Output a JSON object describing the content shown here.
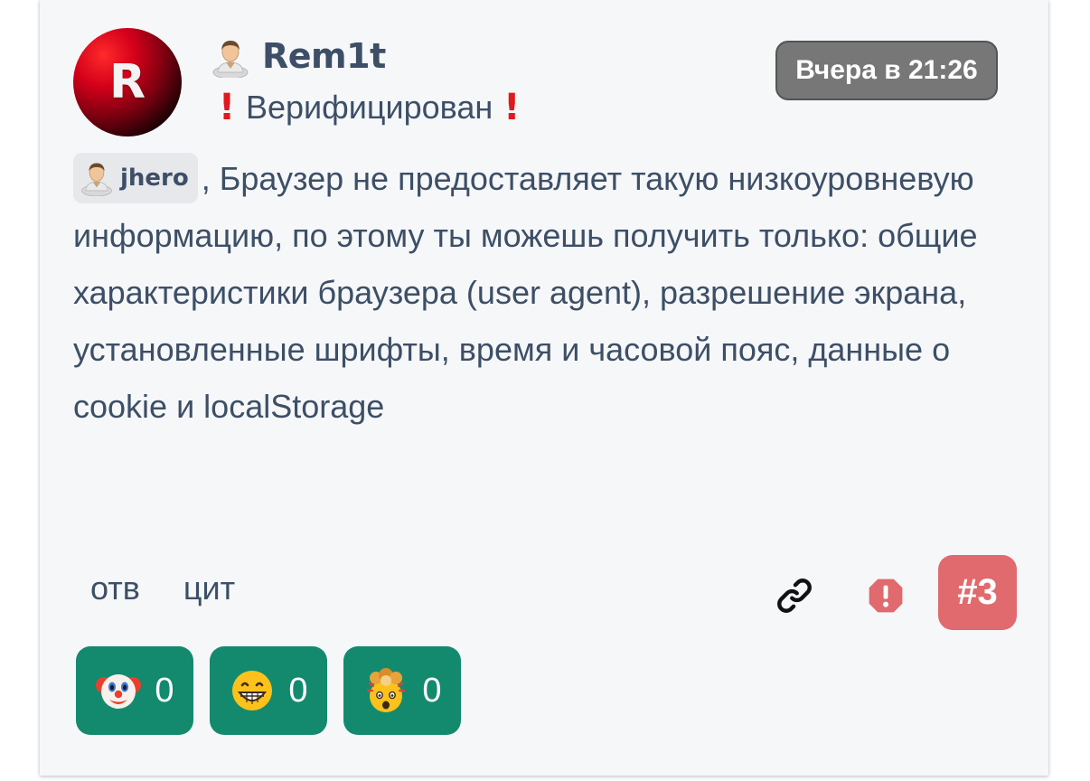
{
  "post": {
    "avatar_letter": "R",
    "username": "Rem1t",
    "user_status": "Верифицирован",
    "date": "Вчера в 21:26",
    "mention": "jhero",
    "message_text": ", Браузер не предоставляет такую низкоуровневую информацию, по этому ты можешь получить только: общие характеристики браузера (user agent), разрешение экрана, установленные шрифты, время и часовой пояс, данные о cookie и localStorage",
    "actions": {
      "reply_label": "отв",
      "quote_label": "цит"
    },
    "post_number": "#3",
    "reactions": [
      {
        "icon": "clown-face-icon",
        "count": "0"
      },
      {
        "icon": "grinning-face-icon",
        "count": "0"
      },
      {
        "icon": "exploding-head-icon",
        "count": "0"
      }
    ]
  },
  "colors": {
    "text": "#3d4f66",
    "date_badge": "#777777",
    "post_number": "#e06a6e",
    "reaction": "#138a6e",
    "exclamation": "#e0191e"
  }
}
